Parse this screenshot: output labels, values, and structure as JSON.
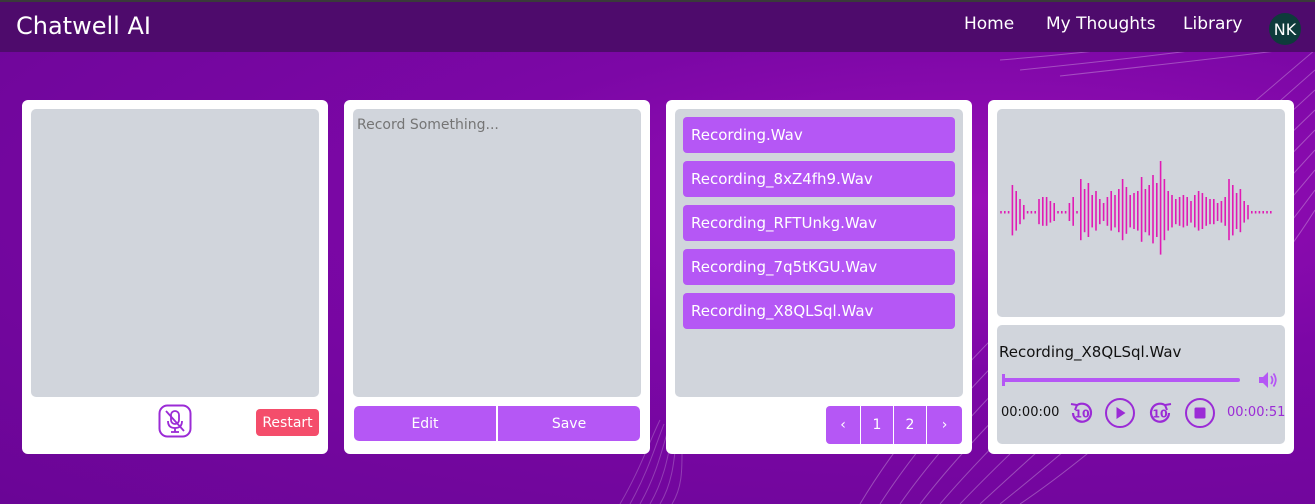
{
  "app": {
    "title": "Chatwell AI"
  },
  "nav": {
    "home": "Home",
    "thoughts": "My Thoughts",
    "library": "Library",
    "avatar_initials": "NK"
  },
  "recorder": {
    "mic_icon": "mic-off-icon",
    "restart_label": "Restart"
  },
  "transcript": {
    "placeholder": "Record Something...",
    "edit_label": "Edit",
    "save_label": "Save"
  },
  "recordings": {
    "items": [
      "Recording.Wav",
      "Recording_8xZ4fh9.Wav",
      "Recording_RFTUnkg.Wav",
      "Recording_7q5tKGU.Wav",
      "Recording_X8QLSql.Wav"
    ],
    "pagination": {
      "prev": "‹",
      "pages": [
        "1",
        "2"
      ],
      "next": "›"
    }
  },
  "player": {
    "filename": "Recording_X8QLSql.Wav",
    "current_time": "00:00:00",
    "duration": "00:00:51",
    "progress": 0,
    "rewind_label": "10",
    "forward_label": "10"
  },
  "colors": {
    "accent": "#b557f5",
    "wave": "#e01bb4",
    "header": "#4e0b6c",
    "danger": "#f44d6b"
  }
}
